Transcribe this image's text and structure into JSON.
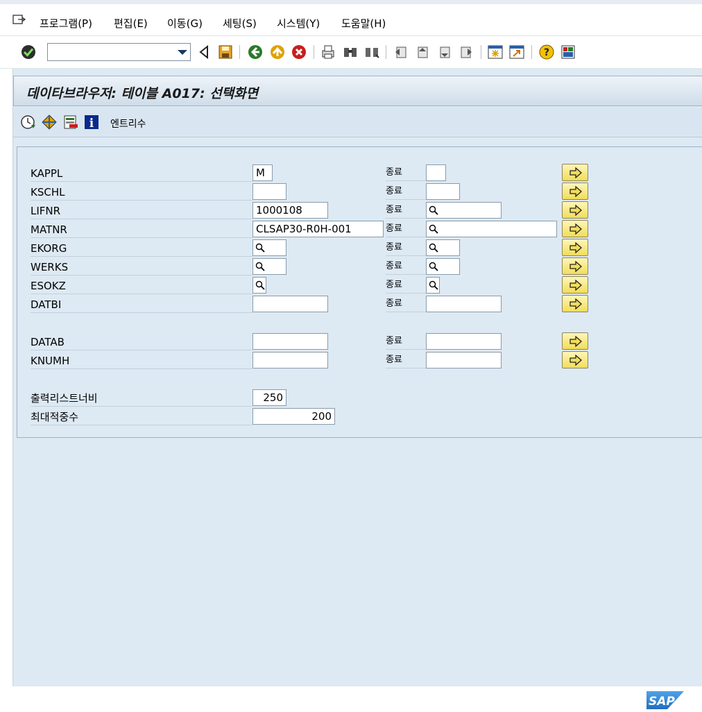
{
  "menu": {
    "items": [
      "프로그램(P)",
      "편집(E)",
      "이동(G)",
      "세팅(S)",
      "시스템(Y)",
      "도움말(H)"
    ]
  },
  "toolbar": {
    "command_field_value": "",
    "icons": [
      "enter-icon",
      "back-icon",
      "save-icon",
      "back-green-icon",
      "exit-icon",
      "cancel-icon",
      "print-icon",
      "find-icon",
      "find-next-icon",
      "first-page-icon",
      "prev-page-icon",
      "next-page-icon",
      "last-page-icon",
      "new-session-icon",
      "shortcut-icon",
      "help-icon",
      "layout-icon"
    ]
  },
  "screen": {
    "title": "데이타브라우저: 테이블 A017: 선택화면",
    "app_toolbar_label": "엔트리수",
    "to_label": "종료"
  },
  "fields": [
    {
      "name": "KAPPL",
      "from": "M",
      "to": ""
    },
    {
      "name": "KSCHL",
      "from": "",
      "to": ""
    },
    {
      "name": "LIFNR",
      "from": "1000108",
      "to": ""
    },
    {
      "name": "MATNR",
      "from": "CLSAP30-R0H-001",
      "to": ""
    },
    {
      "name": "EKORG",
      "from": "",
      "to": ""
    },
    {
      "name": "WERKS",
      "from": "",
      "to": ""
    },
    {
      "name": "ESOKZ",
      "from": "",
      "to": ""
    },
    {
      "name": "DATBI",
      "from": "",
      "to": ""
    },
    {
      "name": "DATAB",
      "from": "",
      "to": ""
    },
    {
      "name": "KNUMH",
      "from": "",
      "to": ""
    }
  ],
  "settings": [
    {
      "label": "출력리스트너비",
      "value": "250"
    },
    {
      "label": "최대적중수",
      "value": "200"
    }
  ],
  "brand": {
    "logo": "SAP",
    "accent": "#1f6fbf",
    "multi_button_color": "#f1dd5a"
  }
}
